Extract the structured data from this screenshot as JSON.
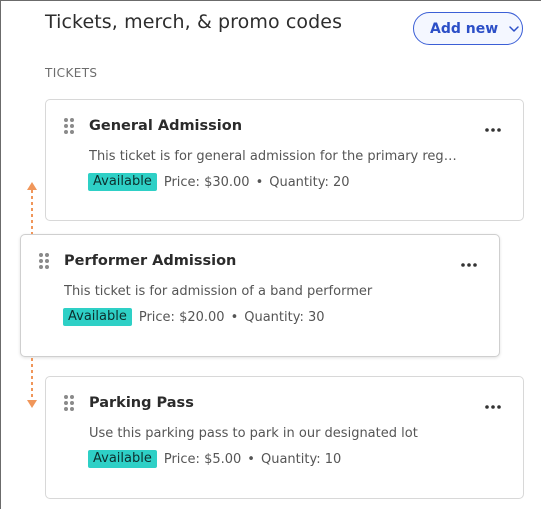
{
  "header": {
    "title": "Tickets, merch, & promo codes",
    "add_button_label": "Add new"
  },
  "section_label": "TICKETS",
  "tickets": [
    {
      "name": "General Admission",
      "description": "This ticket is for general admission for the primary region",
      "status": "Available",
      "price": "Price: $30.00",
      "quantity": "Quantity: 20"
    },
    {
      "name": "Performer Admission",
      "description": "This ticket is for admission of a band performer",
      "status": "Available",
      "price": "Price: $20.00",
      "quantity": "Quantity: 30"
    },
    {
      "name": "Parking Pass",
      "description": "Use this parking pass to park in our designated lot",
      "status": "Available",
      "price": "Price: $5.00",
      "quantity": "Quantity: 10"
    }
  ],
  "separator": "•",
  "colors": {
    "accent": "#3b5fd6",
    "badge": "#2ed0c6",
    "drag_arrow": "#f0965a"
  },
  "icons": {
    "grip": "drag-handle-icon",
    "more": "more-horizontal-icon",
    "chevron": "chevron-down-icon"
  }
}
